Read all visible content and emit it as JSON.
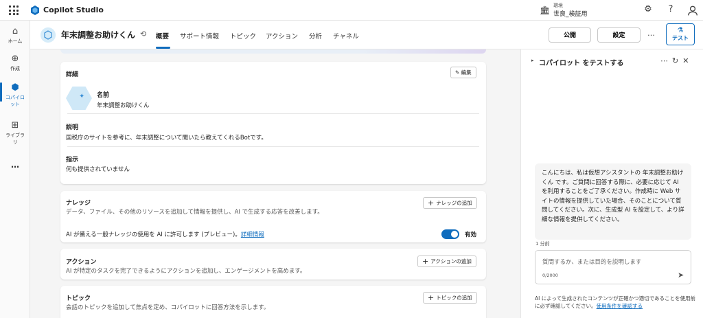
{
  "topbar": {
    "app_name": "Copilot Studio",
    "env_label": "環境",
    "env_name": "世良_検証用",
    "icons": [
      "waffle-icon",
      "copilot-studio-logo",
      "environment-icon",
      "settings-gear-icon",
      "help-icon",
      "account-icon"
    ]
  },
  "leftnav": {
    "items": [
      {
        "label": "ホーム",
        "icon": "home-icon"
      },
      {
        "label": "作成",
        "icon": "add-icon"
      },
      {
        "label": "コパイロット",
        "icon": "copilot-icon"
      },
      {
        "label": "ライブラリ",
        "icon": "library-icon"
      },
      {
        "label": "…",
        "icon": "more-icon"
      }
    ],
    "active": "コパイロット"
  },
  "header": {
    "bot_name": "年末調整お助けくん",
    "tabs": [
      "概要",
      "サポート情報",
      "トピック",
      "アクション",
      "分析",
      "チャネル"
    ],
    "active_tab": "概要",
    "publish_label": "公開",
    "settings_label": "設定",
    "more_label": "…",
    "test_label": "テスト"
  },
  "details": {
    "title": "詳細",
    "edit_label": "編集",
    "name_label": "名前",
    "name_value": "年末調整お助けくん",
    "description_label": "説明",
    "description_value": "国税庁のサイトを参考に、年末調整について聞いたら教えてくれるBotです。",
    "instructions_label": "指示",
    "instructions_value": "何も提供されていません"
  },
  "knowledge": {
    "title": "ナレッジ",
    "description": "データ、ファイル、その他のリソースを追加して情報を提供し、AI で生成する応答を改善します。",
    "add_label": "ナレッジの追加",
    "toggle_text": "AI が備える一般ナレッジの使用を AI に許可します (プレビュー)。",
    "toggle_link": "詳細情報",
    "toggle_state": "有効"
  },
  "actions": {
    "title": "アクション",
    "description": "AI が特定のタスクを完了できるようにアクションを追加し、エンゲージメントを高めます。",
    "add_label": "アクションの追加"
  },
  "topics": {
    "title": "トピック",
    "description": "会話のトピックを追加して焦点を定め、コパイロットに回答方法を示します。",
    "add_label": "トピックの追加"
  },
  "test_panel": {
    "title": "コパイロット をテストする",
    "icons": [
      "more-icon",
      "refresh-icon",
      "close-icon"
    ],
    "bot_message": "こんにちは、私は仮想アシスタントの 年末調整お助けくん です。ご質問に回答する際に、必要に応じて AI を利用することをご了承ください。作成時に Web サイトの情報を提供していた場合、そのことについて質問してください。次に、生成型 AI を設定して、より詳細な情報を提供してください。",
    "message_time": "1 分前",
    "input_placeholder": "質問するか、または目的を説明します",
    "char_count": "0/2000",
    "disclaimer": "AI によって生成されたコンテンツが正確かつ適切であることを使用前に必ず確認してください。",
    "terms_link": "使用条件を確認する"
  }
}
